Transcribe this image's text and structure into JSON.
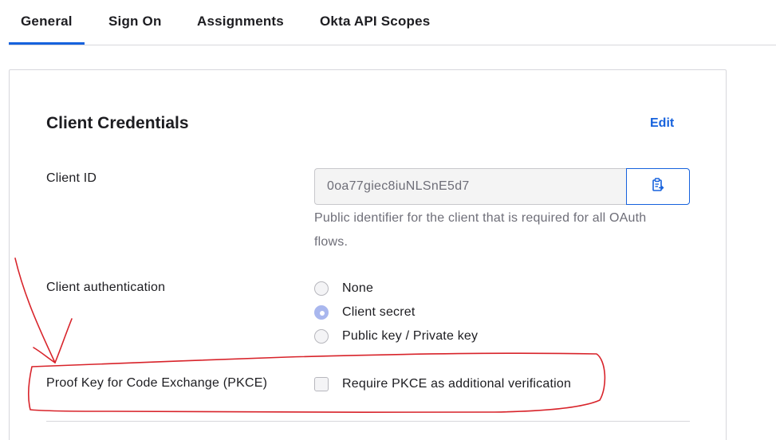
{
  "tabs": [
    {
      "label": "General",
      "active": true
    },
    {
      "label": "Sign On",
      "active": false
    },
    {
      "label": "Assignments",
      "active": false
    },
    {
      "label": "Okta API Scopes",
      "active": false
    }
  ],
  "section": {
    "title": "Client Credentials",
    "edit_label": "Edit"
  },
  "client_id": {
    "label": "Client ID",
    "value": "0oa77giec8iuNLSnE5d7",
    "helper_line1": "Public identifier for the client that is required for all OAuth",
    "helper_line2": "flows.",
    "copy_icon": "clipboard-copy-icon"
  },
  "client_authentication": {
    "label": "Client authentication",
    "options": [
      {
        "label": "None",
        "selected": false
      },
      {
        "label": "Client secret",
        "selected": true
      },
      {
        "label": "Public key / Private key",
        "selected": false
      }
    ]
  },
  "pkce": {
    "label": "Proof Key for Code Exchange (PKCE)",
    "checkbox_label": "Require PKCE as additional verification",
    "checked": false
  },
  "colors": {
    "accent": "#1662dd",
    "annotation": "#d8232a",
    "radio_selected": "#a9b7ee"
  }
}
